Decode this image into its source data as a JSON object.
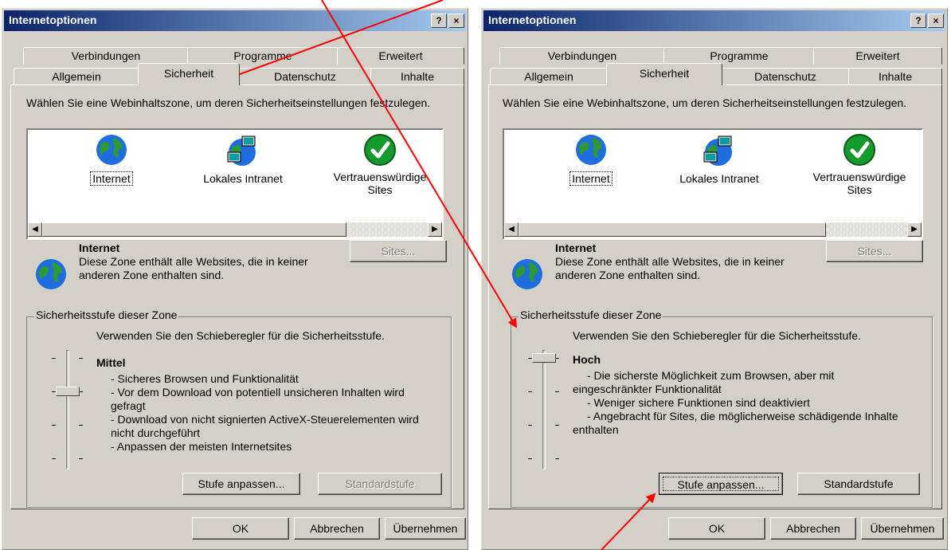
{
  "left_dialog": {
    "title": "Internetoptionen",
    "help_btn": "?",
    "close_btn": "×",
    "tabs_row1": [
      "Verbindungen",
      "Programme",
      "Erweitert"
    ],
    "tabs_row2": [
      "Allgemein",
      "Sicherheit",
      "Datenschutz",
      "Inhalte"
    ],
    "active_tab": "Sicherheit",
    "instruction": "Wählen Sie eine Webinhaltszone, um deren Sicherheitseinstellungen festzulegen.",
    "zones": [
      "Internet",
      "Lokales Intranet",
      "Vertrauenswürdige Sites"
    ],
    "selected_zone": "Internet",
    "zone_title": "Internet",
    "zone_desc": "Diese Zone enthält alle Websites, die in keiner anderen Zone enthalten sind.",
    "sites_btn": "Sites...",
    "group_caption": "Sicherheitsstufe dieser Zone",
    "slider_hint": "Verwenden Sie den Schieberegler für die Sicherheitsstufe.",
    "level_name": "Mittel",
    "level_lines": [
      "- Sicheres Browsen und Funktionalität",
      "- Vor dem Download von potentiell unsicheren Inhalten wird gefragt",
      "- Download von nicht signierten ActiveX-Steuerelementen wird nicht durchgeführt",
      "- Anpassen der meisten Internetsites"
    ],
    "slider_level": "Mittel",
    "custom_btn": "Stufe anpassen...",
    "default_btn": "Standardstufe",
    "default_btn_enabled": false,
    "ok_btn": "OK",
    "cancel_btn": "Abbrechen",
    "apply_btn": "Übernehmen"
  },
  "right_dialog": {
    "title": "Internetoptionen",
    "help_btn": "?",
    "close_btn": "×",
    "tabs_row1": [
      "Verbindungen",
      "Programme",
      "Erweitert"
    ],
    "tabs_row2": [
      "Allgemein",
      "Sicherheit",
      "Datenschutz",
      "Inhalte"
    ],
    "active_tab": "Sicherheit",
    "instruction": "Wählen Sie eine Webinhaltszone, um deren Sicherheitseinstellungen festzulegen.",
    "zones": [
      "Internet",
      "Lokales Intranet",
      "Vertrauenswürdige Sites"
    ],
    "selected_zone": "Internet",
    "zone_title": "Internet",
    "zone_desc": "Diese Zone enthält alle Websites, die in keiner anderen Zone enthalten sind.",
    "sites_btn": "Sites...",
    "group_caption": "Sicherheitsstufe dieser Zone",
    "slider_hint": "Verwenden Sie den Schieberegler für die Sicherheitsstufe.",
    "level_name": "Hoch",
    "level_lines": [
      "- Die sicherste Möglichkeit zum Browsen, aber mit eingeschränkter Funktionalität",
      "- Weniger sichere Funktionen sind deaktiviert",
      "- Angebracht für Sites, die möglicherweise schädigende Inhalte enthalten"
    ],
    "slider_level": "Hoch",
    "custom_btn": "Stufe anpassen...",
    "default_btn": "Standardstufe",
    "default_btn_enabled": true,
    "ok_btn": "OK",
    "cancel_btn": "Abbrechen",
    "apply_btn": "Übernehmen"
  },
  "colors": {
    "dialog_face": "#d4d0c8",
    "titlebar_start": "#0a246a",
    "titlebar_end": "#a6caf0",
    "annotation_arrow": "#ff0000"
  }
}
